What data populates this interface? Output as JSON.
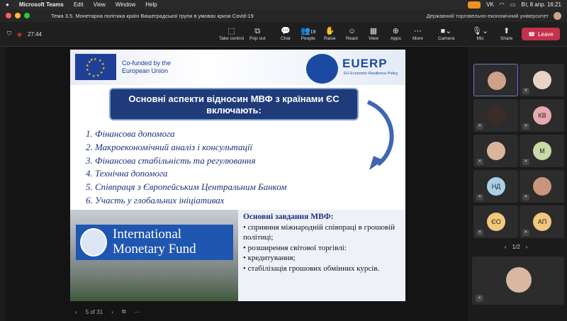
{
  "menubar": {
    "app_name": "Microsoft Teams",
    "items": [
      "Edit",
      "View",
      "Window",
      "Help"
    ],
    "datetime": "Вт, 8 апр.  16:21",
    "vk": "VK"
  },
  "window": {
    "title": "Тема 3.5. Монетарна політика країн Вишеградської групи в умовах кризи Covid-19",
    "org": "Державний торговельно-економічний університет"
  },
  "toolbar": {
    "timer": "27:44",
    "buttons": {
      "take_control": "Take control",
      "pop_out": "Pop out",
      "chat": "Chat",
      "people": "People",
      "people_count": "19",
      "raise": "Raise",
      "react": "React",
      "view": "View",
      "apps": "Apps",
      "more": "More",
      "camera": "Camera",
      "mic": "Mic",
      "share": "Share",
      "leave": "Leave"
    }
  },
  "slide": {
    "eu_text_line1": "Co-funded by the",
    "eu_text_line2": "European Union",
    "euerp_title": "EUERP",
    "euerp_sub": "EU Economic Resilience Policy",
    "heading_line1": "Основні аспекти відносин МВФ з країнами ЄС",
    "heading_line2": "включають:",
    "list": [
      "1.  Фінансова допомога",
      "2.  Макроекономічний аналіз і консультації",
      "3.  Фінансова стабільність та регулювання",
      "4.  Технічна допомога",
      "5.  Співпраця з Європейським Центральним Банком",
      "6.   Участь у глобальних ініціативах"
    ],
    "imf_line1": "International",
    "imf_line2": "Monetary Fund",
    "tasks_heading": "Основні завдання МВФ:",
    "tasks": [
      "• сприяння міжнародній співпраці в грошовій політиці;",
      "• розширення світової торгівлі:",
      "• кредитування;",
      "• стабілізація грошових обмінних курсів."
    ]
  },
  "slide_nav": {
    "counter": "5 of 31"
  },
  "gallery": {
    "initials": [
      "КВ",
      "М",
      "НД",
      "ЄО",
      "АП"
    ],
    "pager": "1/2"
  },
  "colors": {
    "leave": "#c4314b",
    "accent": "#6a74d9",
    "slide_blue": "#17317a"
  }
}
